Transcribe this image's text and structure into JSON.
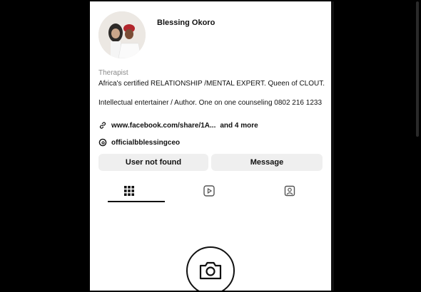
{
  "profile": {
    "username": "Blessing Okoro",
    "category": "Therapist",
    "bio_line1": "Africa's certified RELATIONSHIP /MENTAL EXPERT. Queen of CLOUT.",
    "bio_line2": "Intellectual entertainer / Author. One on one counseling 0802 216 1233",
    "link_url": "www.facebook.com/share/1A...",
    "link_more": "and 4 more",
    "threads_handle": "officialbblessingceo"
  },
  "actions": {
    "primary_label": "User not found",
    "secondary_label": "Message"
  },
  "tabs": [
    {
      "name": "grid",
      "icon": "grid-icon",
      "active": true
    },
    {
      "name": "reels",
      "icon": "reels-icon",
      "active": false
    },
    {
      "name": "tagged",
      "icon": "tagged-icon",
      "active": false
    }
  ],
  "empty_state": {
    "icon": "camera-icon"
  }
}
